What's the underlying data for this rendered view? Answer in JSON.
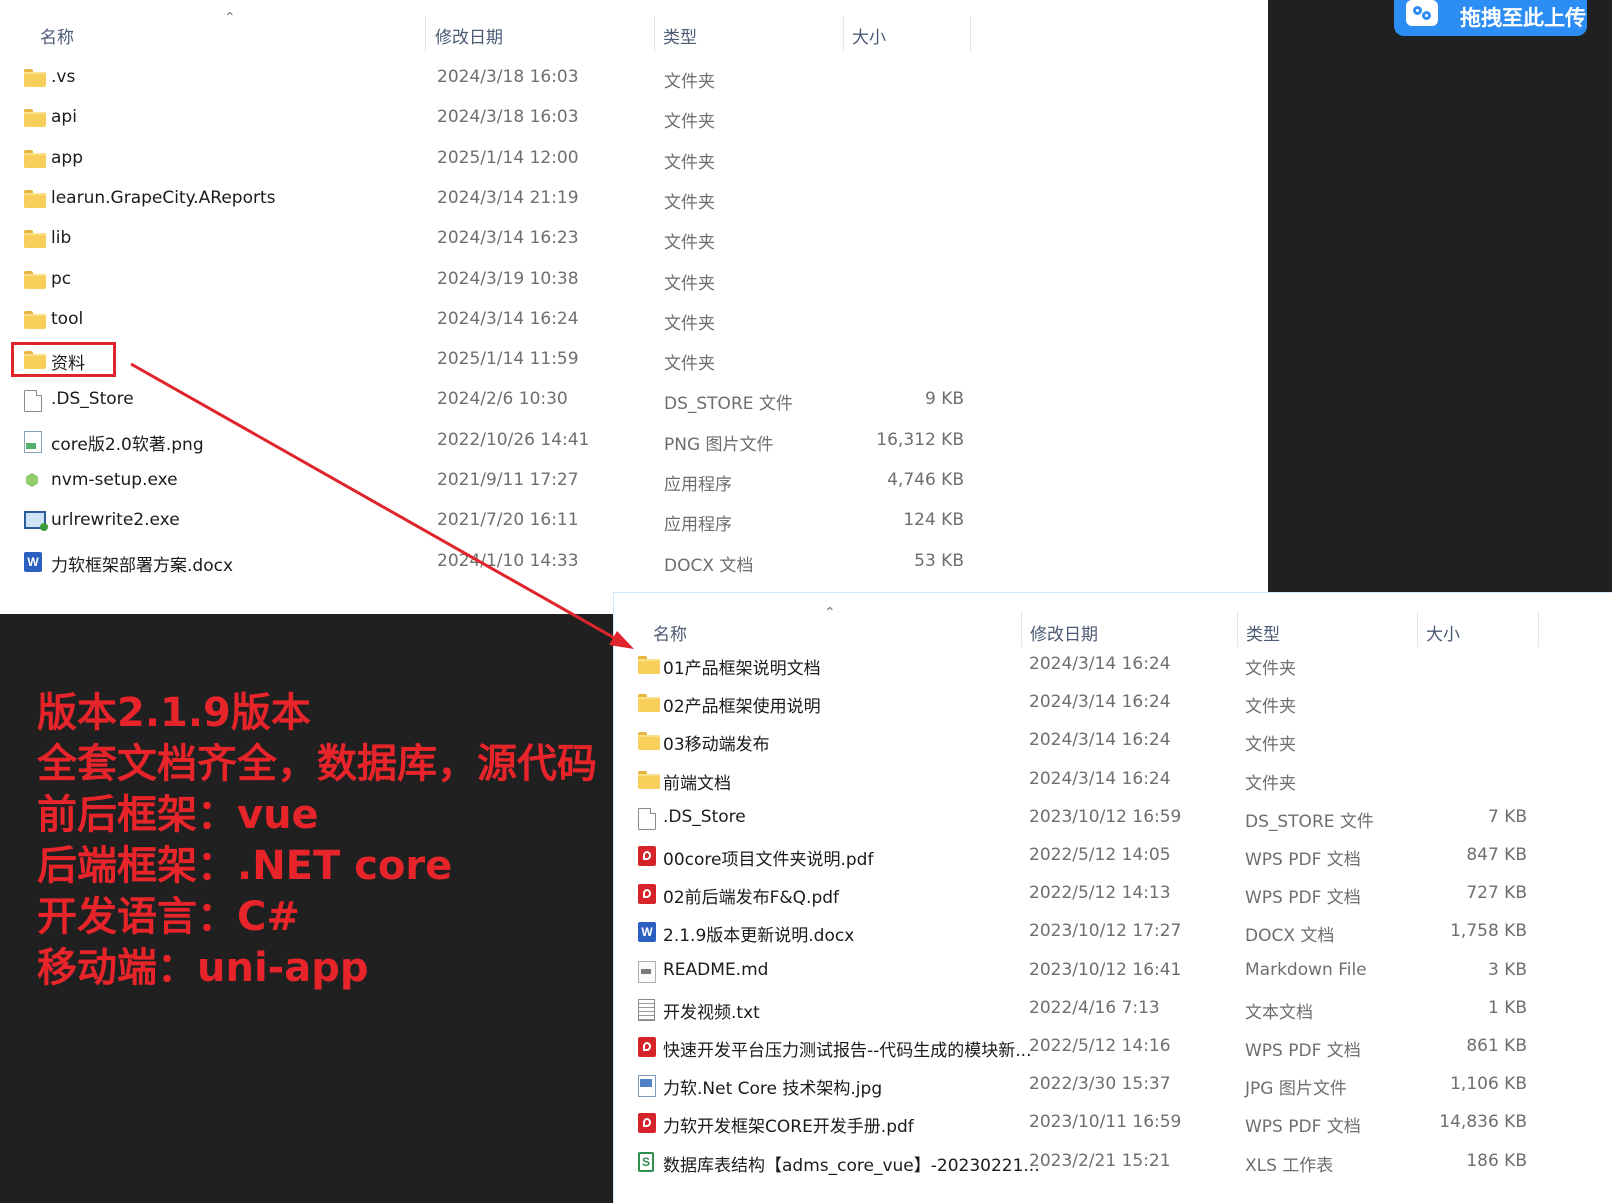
{
  "explorer_top": {
    "columns": {
      "name": "名称",
      "date": "修改日期",
      "type": "类型",
      "size": "大小"
    },
    "rows": [
      {
        "name": ".vs",
        "date": "2024/3/18 16:03",
        "type": "文件夹",
        "size": "",
        "icon": "folder-icon"
      },
      {
        "name": "api",
        "date": "2024/3/18 16:03",
        "type": "文件夹",
        "size": "",
        "icon": "folder-icon"
      },
      {
        "name": "app",
        "date": "2025/1/14 12:00",
        "type": "文件夹",
        "size": "",
        "icon": "folder-icon"
      },
      {
        "name": "learun.GrapeCity.AReports",
        "date": "2024/3/14 21:19",
        "type": "文件夹",
        "size": "",
        "icon": "folder-icon"
      },
      {
        "name": "lib",
        "date": "2024/3/14 16:23",
        "type": "文件夹",
        "size": "",
        "icon": "folder-icon"
      },
      {
        "name": "pc",
        "date": "2024/3/19 10:38",
        "type": "文件夹",
        "size": "",
        "icon": "folder-icon"
      },
      {
        "name": "tool",
        "date": "2024/3/14 16:24",
        "type": "文件夹",
        "size": "",
        "icon": "folder-icon"
      },
      {
        "name": "资料",
        "date": "2025/1/14 11:59",
        "type": "文件夹",
        "size": "",
        "icon": "folder-icon"
      },
      {
        "name": ".DS_Store",
        "date": "2024/2/6 10:30",
        "type": "DS_STORE 文件",
        "size": "9 KB",
        "icon": "file-icon"
      },
      {
        "name": "core版2.0软著.png",
        "date": "2022/10/26 14:41",
        "type": "PNG 图片文件",
        "size": "16,312 KB",
        "icon": "png-icon"
      },
      {
        "name": "nvm-setup.exe",
        "date": "2021/9/11 17:27",
        "type": "应用程序",
        "size": "4,746 KB",
        "icon": "nvm-exe-icon"
      },
      {
        "name": "urlrewrite2.exe",
        "date": "2021/7/20 16:11",
        "type": "应用程序",
        "size": "124 KB",
        "icon": "installer-exe-icon"
      },
      {
        "name": "力软框架部署方案.docx",
        "date": "2024/1/10 14:33",
        "type": "DOCX 文档",
        "size": "53 KB",
        "icon": "word-icon"
      }
    ]
  },
  "explorer_bottom": {
    "columns": {
      "name": "名称",
      "date": "修改日期",
      "type": "类型",
      "size": "大小"
    },
    "rows": [
      {
        "name": "01产品框架说明文档",
        "date": "2024/3/14 16:24",
        "type": "文件夹",
        "size": "",
        "icon": "folder-icon"
      },
      {
        "name": "02产品框架使用说明",
        "date": "2024/3/14 16:24",
        "type": "文件夹",
        "size": "",
        "icon": "folder-icon"
      },
      {
        "name": "03移动端发布",
        "date": "2024/3/14 16:24",
        "type": "文件夹",
        "size": "",
        "icon": "folder-icon"
      },
      {
        "name": "前端文档",
        "date": "2024/3/14 16:24",
        "type": "文件夹",
        "size": "",
        "icon": "folder-icon"
      },
      {
        "name": ".DS_Store",
        "date": "2023/10/12 16:59",
        "type": "DS_STORE 文件",
        "size": "7 KB",
        "icon": "file-icon"
      },
      {
        "name": "00core项目文件夹说明.pdf",
        "date": "2022/5/12 14:05",
        "type": "WPS PDF 文档",
        "size": "847 KB",
        "icon": "pdf-icon"
      },
      {
        "name": "02前后端发布F&Q.pdf",
        "date": "2022/5/12 14:13",
        "type": "WPS PDF 文档",
        "size": "727 KB",
        "icon": "pdf-icon"
      },
      {
        "name": "2.1.9版本更新说明.docx",
        "date": "2023/10/12 17:27",
        "type": "DOCX 文档",
        "size": "1,758 KB",
        "icon": "word-icon"
      },
      {
        "name": "README.md",
        "date": "2023/10/12 16:41",
        "type": "Markdown File",
        "size": "3 KB",
        "icon": "markdown-icon"
      },
      {
        "name": "开发视频.txt",
        "date": "2022/4/16 7:13",
        "type": "文本文档",
        "size": "1 KB",
        "icon": "text-file-icon"
      },
      {
        "name": "快速开发平台压力测试报告--代码生成的模块新...",
        "date": "2022/5/12 14:16",
        "type": "WPS PDF 文档",
        "size": "861 KB",
        "icon": "pdf-icon"
      },
      {
        "name": "力软.Net Core 技术架构.jpg",
        "date": "2022/3/30 15:37",
        "type": "JPG 图片文件",
        "size": "1,106 KB",
        "icon": "jpg-icon"
      },
      {
        "name": "力软开发框架CORE开发手册.pdf",
        "date": "2023/10/11 16:59",
        "type": "WPS PDF 文档",
        "size": "14,836 KB",
        "icon": "pdf-icon"
      },
      {
        "name": "数据库表结构【adms_core_vue】-20230221...",
        "date": "2023/2/21 15:21",
        "type": "XLS 工作表",
        "size": "186 KB",
        "icon": "xls-icon"
      }
    ]
  },
  "overlay": {
    "lines": [
      "版本2.1.9版本",
      "全套文档齐全，数据库，源代码",
      "前后框架：vue",
      "后端框架：.NET core",
      "开发语言：C#",
      "移动端：uni-app"
    ]
  },
  "upload_button": {
    "label": "拖拽至此上传"
  },
  "colors": {
    "annotation_red": "#e0242b",
    "upload_blue": "#2c8df5",
    "background_dark": "#202020"
  }
}
